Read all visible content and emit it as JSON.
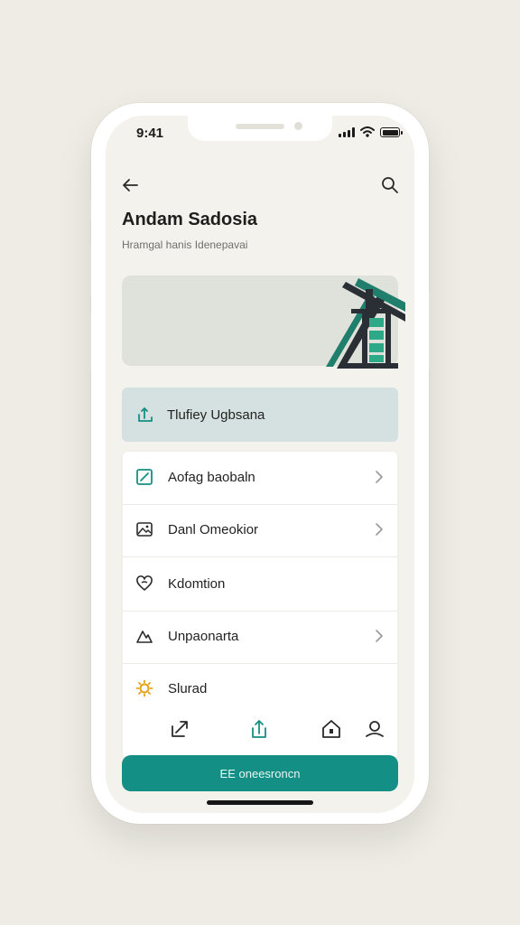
{
  "status_bar": {
    "time": "9:41"
  },
  "header": {
    "title": "Andam Sadosia",
    "subtitle": "Hramgal hanis Idenepavai"
  },
  "highlight": {
    "label": "Tlufiey Ugbsana"
  },
  "menu": {
    "items": [
      {
        "label": "Aofag baobaln",
        "icon": "edit-square-icon",
        "chevron": true
      },
      {
        "label": "Danl Omeokior",
        "icon": "image-icon",
        "chevron": true
      },
      {
        "label": "Kdomtion",
        "icon": "heart-icon",
        "chevron": false
      },
      {
        "label": "Unpaonarta",
        "icon": "mountain-icon",
        "chevron": true
      },
      {
        "label": "Slurad",
        "icon": "sun-icon",
        "chevron": false
      }
    ]
  },
  "tabs": [
    "share-icon",
    "upload-icon",
    "home-icon",
    "profile-icon"
  ],
  "cta": {
    "label": "EE oneesroncn"
  },
  "colors": {
    "accent": "#148f85",
    "background": "#eeece4",
    "screen": "#f4f2ec"
  }
}
